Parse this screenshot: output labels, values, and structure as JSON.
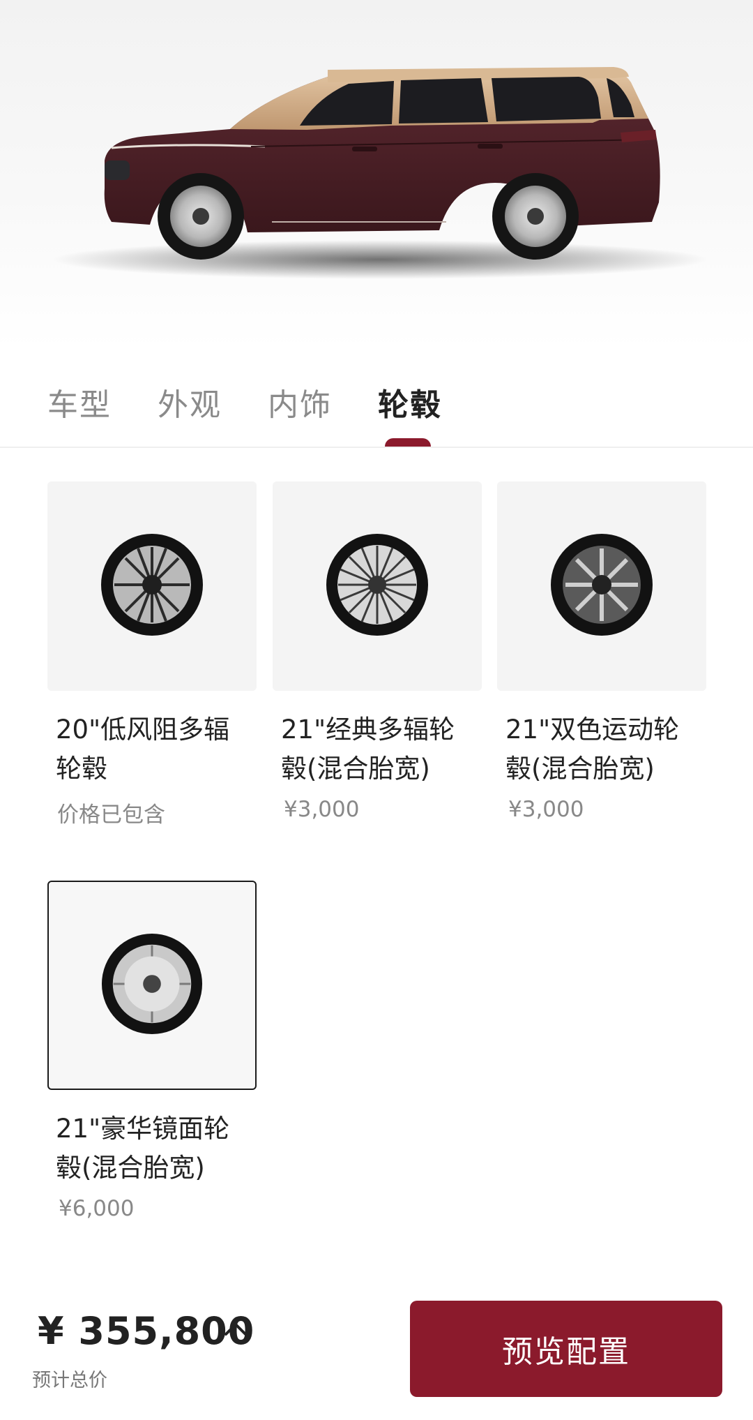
{
  "hero": {
    "car_image": "car-side-view"
  },
  "tabs": [
    {
      "label": "车型",
      "active": false
    },
    {
      "label": "外观",
      "active": false
    },
    {
      "label": "内饰",
      "active": false
    },
    {
      "label": "轮毂",
      "active": true
    }
  ],
  "wheels": [
    {
      "title_line1": "20\"低风阻多辐",
      "title_line2": "轮毂",
      "price": "价格已包含",
      "selected": false,
      "icon": "wheel-aero"
    },
    {
      "title_line1": "21\"经典多辐轮",
      "title_line2": "毂(混合胎宽)",
      "price": "¥3,000",
      "selected": false,
      "icon": "wheel-multi-spoke"
    },
    {
      "title_line1": "21\"双色运动轮",
      "title_line2": "毂(混合胎宽)",
      "price": "¥3,000",
      "selected": false,
      "icon": "wheel-sport"
    },
    {
      "title_line1": "21\"豪华镜面轮",
      "title_line2": "毂(混合胎宽)",
      "price": "¥6,000",
      "selected": true,
      "icon": "wheel-mirror"
    }
  ],
  "footer": {
    "total_price": "¥ 355,800",
    "total_label": "预计总价",
    "preview_button": "预览配置"
  },
  "colors": {
    "accent": "#8b1a2c",
    "body": "#4a1f24",
    "roof": "#caa582"
  }
}
